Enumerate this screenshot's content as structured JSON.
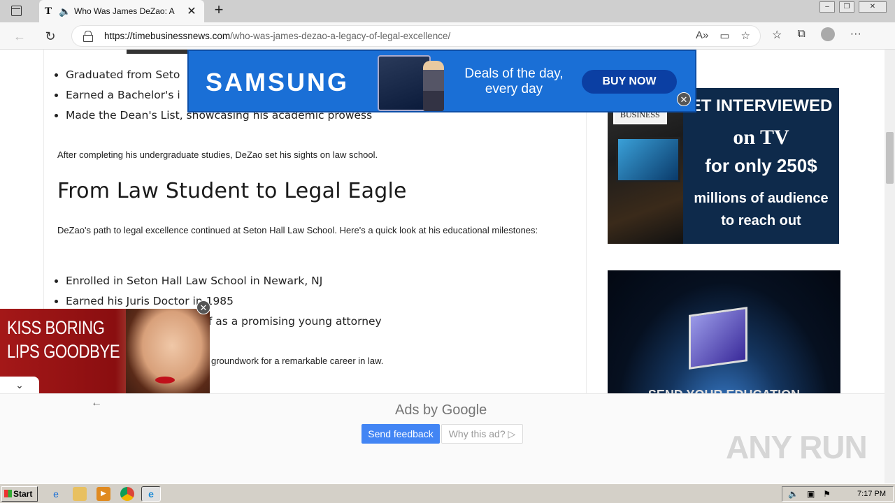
{
  "browser": {
    "tab_title": "Who Was James DeZao: A",
    "tab_favicon": "T",
    "url_domain": "https://timebusinessnews.com",
    "url_path": "/who-was-james-dezao-a-legacy-of-legal-excellence/"
  },
  "article": {
    "list1": [
      "Graduated from Seto",
      "Earned a Bachelor's i",
      "Made the Dean's List, showcasing his academic prowess"
    ],
    "para1": "After completing his undergraduate studies, DeZao set his sights on law school.",
    "heading": "From Law Student to Legal Eagle",
    "para2": "DeZao's path to legal excellence continued at Seton Hall Law School. Here's a quick look at his educational milestones:",
    "list2": [
      "Enrolled in Seton Hall Law School in Newark, NJ",
      "Earned his Juris Doctor in 1985",
      "elf as a promising young attorney"
    ],
    "para3": "groundwork for a remarkable career in law."
  },
  "ads": {
    "samsung": {
      "brand": "SAMSUNG",
      "deal_line1": "Deals of the day,",
      "deal_line2": "every day",
      "button": "BUY NOW"
    },
    "tv": {
      "badge": "BUSINESS",
      "line1": "ET INTERVIEWED",
      "line2": "on TV",
      "line3": "for only 250$",
      "line4": "millions of audience",
      "line5": "to reach out"
    },
    "lips": {
      "line1": "KISS BORING",
      "line2": "LIPS GOODBYE"
    },
    "space_partial": "SEND YOUR EDUCATION",
    "adsby": "Ads by Google",
    "send_feedback": "Send feedback",
    "why_ad": "Why this ad? ▷"
  },
  "watermark": "ANY RUN",
  "taskbar": {
    "start": "Start",
    "clock": "7:17 PM"
  }
}
